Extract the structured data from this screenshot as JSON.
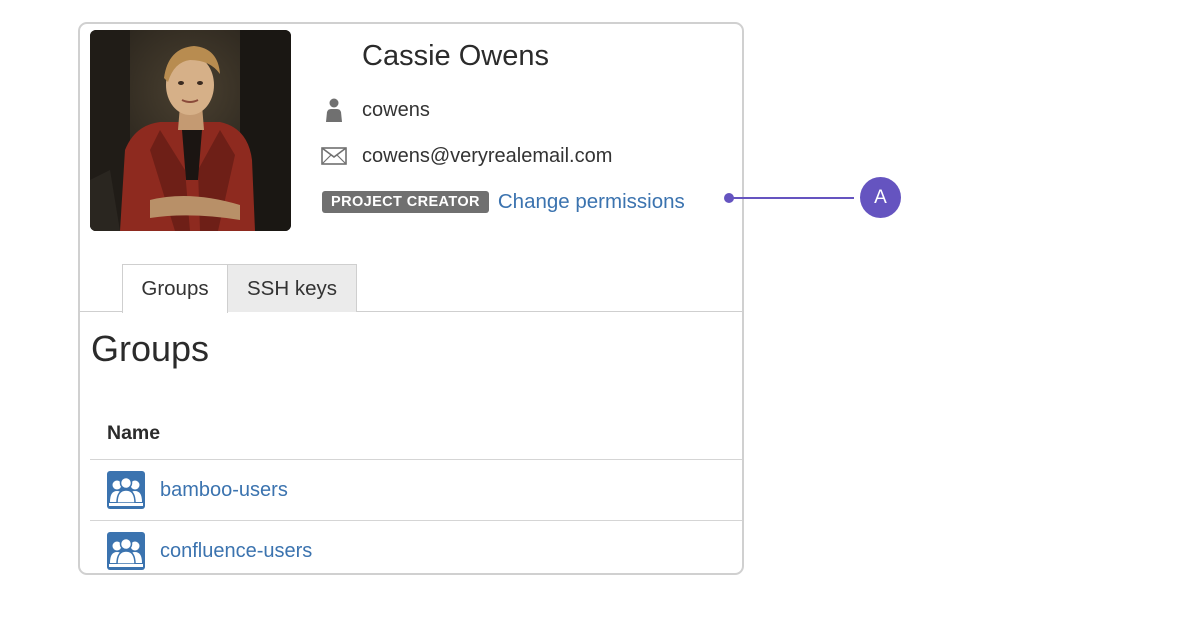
{
  "user": {
    "full_name": "Cassie Owens",
    "username": "cowens",
    "email": "cowens@veryrealemail.com",
    "role_badge": "PROJECT CREATOR",
    "change_permissions_label": "Change permissions"
  },
  "tabs": [
    {
      "label": "Groups",
      "active": true
    },
    {
      "label": "SSH keys",
      "active": false
    }
  ],
  "groups_section": {
    "title": "Groups",
    "column_header": "Name",
    "rows": [
      {
        "name": "bamboo-users"
      },
      {
        "name": "confluence-users"
      }
    ]
  },
  "callout": {
    "label": "A"
  },
  "colors": {
    "link": "#3b73af",
    "badge_bg": "#707070",
    "callout": "#6554c0",
    "group_icon": "#3b73af"
  },
  "icons": {
    "username": "person-icon",
    "email": "envelope-icon",
    "group": "group-icon"
  }
}
